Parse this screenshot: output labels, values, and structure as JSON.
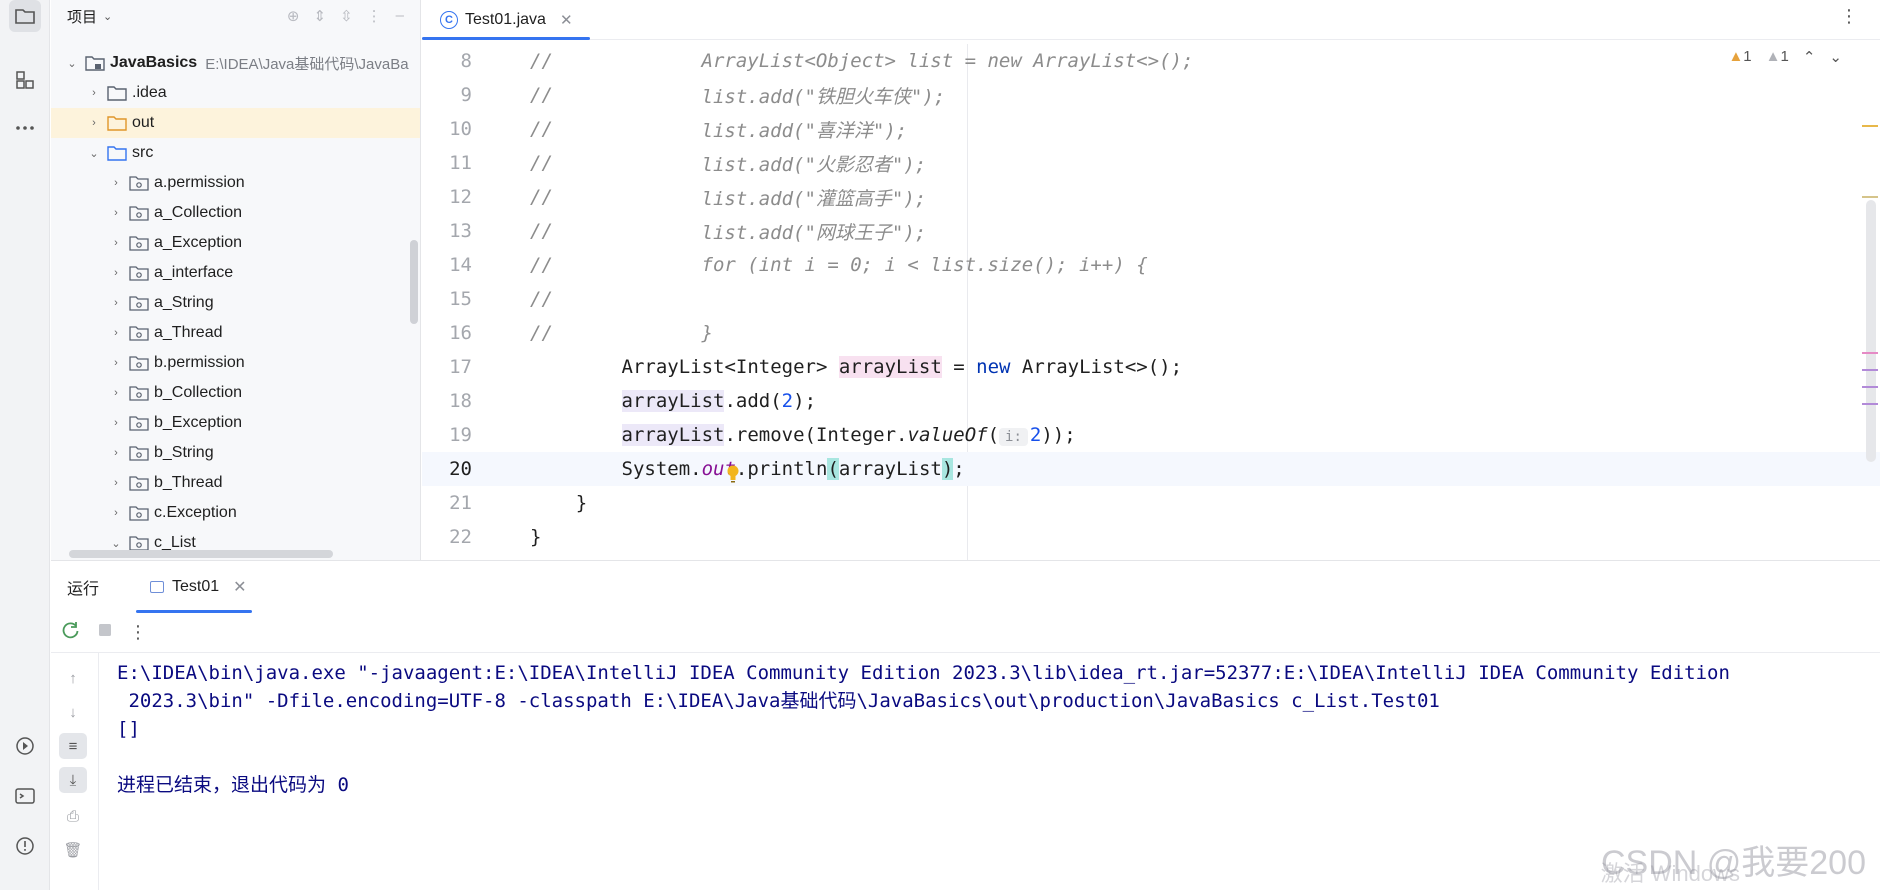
{
  "project_panel": {
    "title": "项目",
    "root": {
      "name": "JavaBasics",
      "path": "E:\\IDEA\\Java基础代码\\JavaBa"
    },
    "items": [
      {
        "label": ".idea",
        "level": 1,
        "type": "folder",
        "arrow": "›"
      },
      {
        "label": "out",
        "level": 1,
        "type": "folder-out",
        "arrow": "›"
      },
      {
        "label": "src",
        "level": 1,
        "type": "folder-src",
        "arrow": "⌄"
      },
      {
        "label": "a.permission",
        "level": 2,
        "type": "package",
        "arrow": "›"
      },
      {
        "label": "a_Collection",
        "level": 2,
        "type": "package",
        "arrow": "›"
      },
      {
        "label": "a_Exception",
        "level": 2,
        "type": "package",
        "arrow": "›"
      },
      {
        "label": "a_interface",
        "level": 2,
        "type": "package",
        "arrow": "›"
      },
      {
        "label": "a_String",
        "level": 2,
        "type": "package",
        "arrow": "›"
      },
      {
        "label": "a_Thread",
        "level": 2,
        "type": "package",
        "arrow": "›"
      },
      {
        "label": "b.permission",
        "level": 2,
        "type": "package",
        "arrow": "›"
      },
      {
        "label": "b_Collection",
        "level": 2,
        "type": "package",
        "arrow": "›"
      },
      {
        "label": "b_Exception",
        "level": 2,
        "type": "package",
        "arrow": "›"
      },
      {
        "label": "b_String",
        "level": 2,
        "type": "package",
        "arrow": "›"
      },
      {
        "label": "b_Thread",
        "level": 2,
        "type": "package",
        "arrow": "›"
      },
      {
        "label": "c.Exception",
        "level": 2,
        "type": "package",
        "arrow": "›"
      },
      {
        "label": "c_List",
        "level": 2,
        "type": "package",
        "arrow": "⌄"
      }
    ]
  },
  "editor": {
    "tab_label": "Test01.java",
    "tab_icon": "C",
    "inspections": {
      "warnings_a": "1",
      "warnings_b": "1"
    },
    "lines": [
      {
        "n": "8",
        "c": "//",
        "code": "        ArrayList<Object> list = new ArrayList<>();"
      },
      {
        "n": "9",
        "c": "//",
        "code": "        list.add(\"铁胆火车侠\");"
      },
      {
        "n": "10",
        "c": "//",
        "code": "        list.add(\"喜洋洋\");"
      },
      {
        "n": "11",
        "c": "//",
        "code": "        list.add(\"火影忍者\");"
      },
      {
        "n": "12",
        "c": "//",
        "code": "        list.add(\"灌篮高手\");"
      },
      {
        "n": "13",
        "c": "//",
        "code": "        list.add(\"网球王子\");"
      },
      {
        "n": "14",
        "c": "//",
        "code": "        for (int i = 0; i < list.size(); i++) {"
      },
      {
        "n": "15",
        "c": "//",
        "code": ""
      },
      {
        "n": "16",
        "c": "//",
        "code": "        }"
      }
    ],
    "line17": {
      "n": "17",
      "indent": "        ",
      "t1": "ArrayList<Integer> ",
      "var": "arrayList",
      "t2": " = ",
      "kw": "new",
      "t3": " ArrayList<>();"
    },
    "line18": {
      "n": "18",
      "indent": "        ",
      "var": "arrayList",
      "t1": ".add(",
      "num": "2",
      "t2": ");"
    },
    "line19": {
      "n": "19",
      "indent": "        ",
      "var": "arrayList",
      "t1": ".remove(Integer.",
      "meth": "valueOf",
      "t2": "(",
      "hint": "i:",
      "num": "2",
      "t3": "));"
    },
    "line20": {
      "n": "20",
      "indent": "        ",
      "t1": "System.",
      "fld": "out",
      "t2": ".println",
      "p1": "(",
      "var": "arrayList",
      "p2": ")",
      "t3": ";"
    },
    "line21": {
      "n": "21",
      "code": "    }"
    },
    "line22": {
      "n": "22",
      "code": "}"
    }
  },
  "run_panel": {
    "title": "运行",
    "tab_label": "Test01",
    "console": [
      "E:\\IDEA\\bin\\java.exe \"-javaagent:E:\\IDEA\\IntelliJ IDEA Community Edition 2023.3\\lib\\idea_rt.jar=52377:E:\\IDEA\\IntelliJ IDEA Community Edition",
      " 2023.3\\bin\" -Dfile.encoding=UTF-8 -classpath E:\\IDEA\\Java基础代码\\JavaBasics\\out\\production\\JavaBasics c_List.Test01",
      "[]",
      "",
      "进程已结束，退出代码为 0"
    ]
  },
  "watermark": {
    "text": "CSDN @我要200",
    "activate": "激活 Windows"
  },
  "colors": {
    "accent": "#3574f0",
    "keyword": "#0033b3",
    "number": "#1750eb",
    "comment": "#8c8c8c",
    "field": "#871094",
    "console": "#0a0a80"
  }
}
